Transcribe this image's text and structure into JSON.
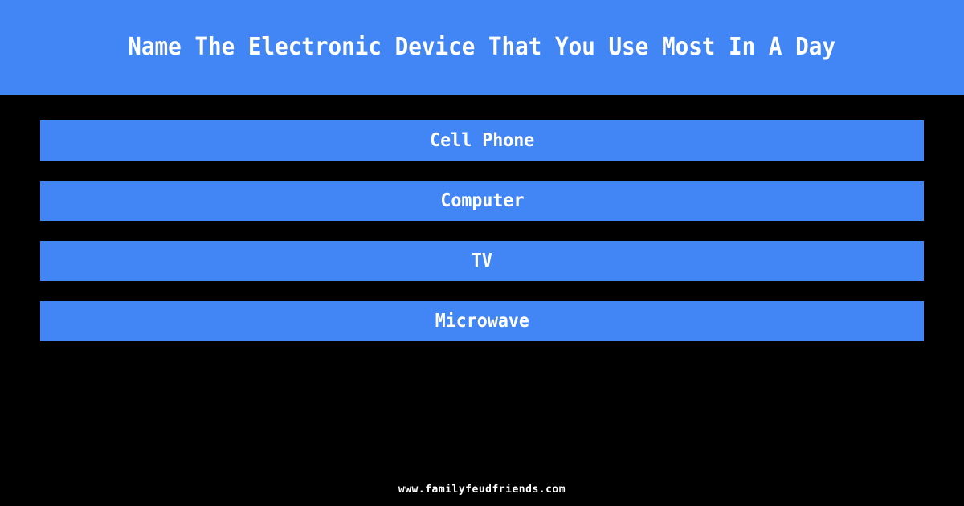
{
  "theme": {
    "background_color": "#000000",
    "accent_color": "#4285F4",
    "text_color": "#FFFFFF"
  },
  "header": {
    "title": "Name The Electronic Device That You Use Most In A Day"
  },
  "answers": [
    {
      "label": "Cell Phone"
    },
    {
      "label": "Computer"
    },
    {
      "label": "TV"
    },
    {
      "label": "Microwave"
    }
  ],
  "footer": {
    "site_url": "www.familyfeudfriends.com"
  }
}
